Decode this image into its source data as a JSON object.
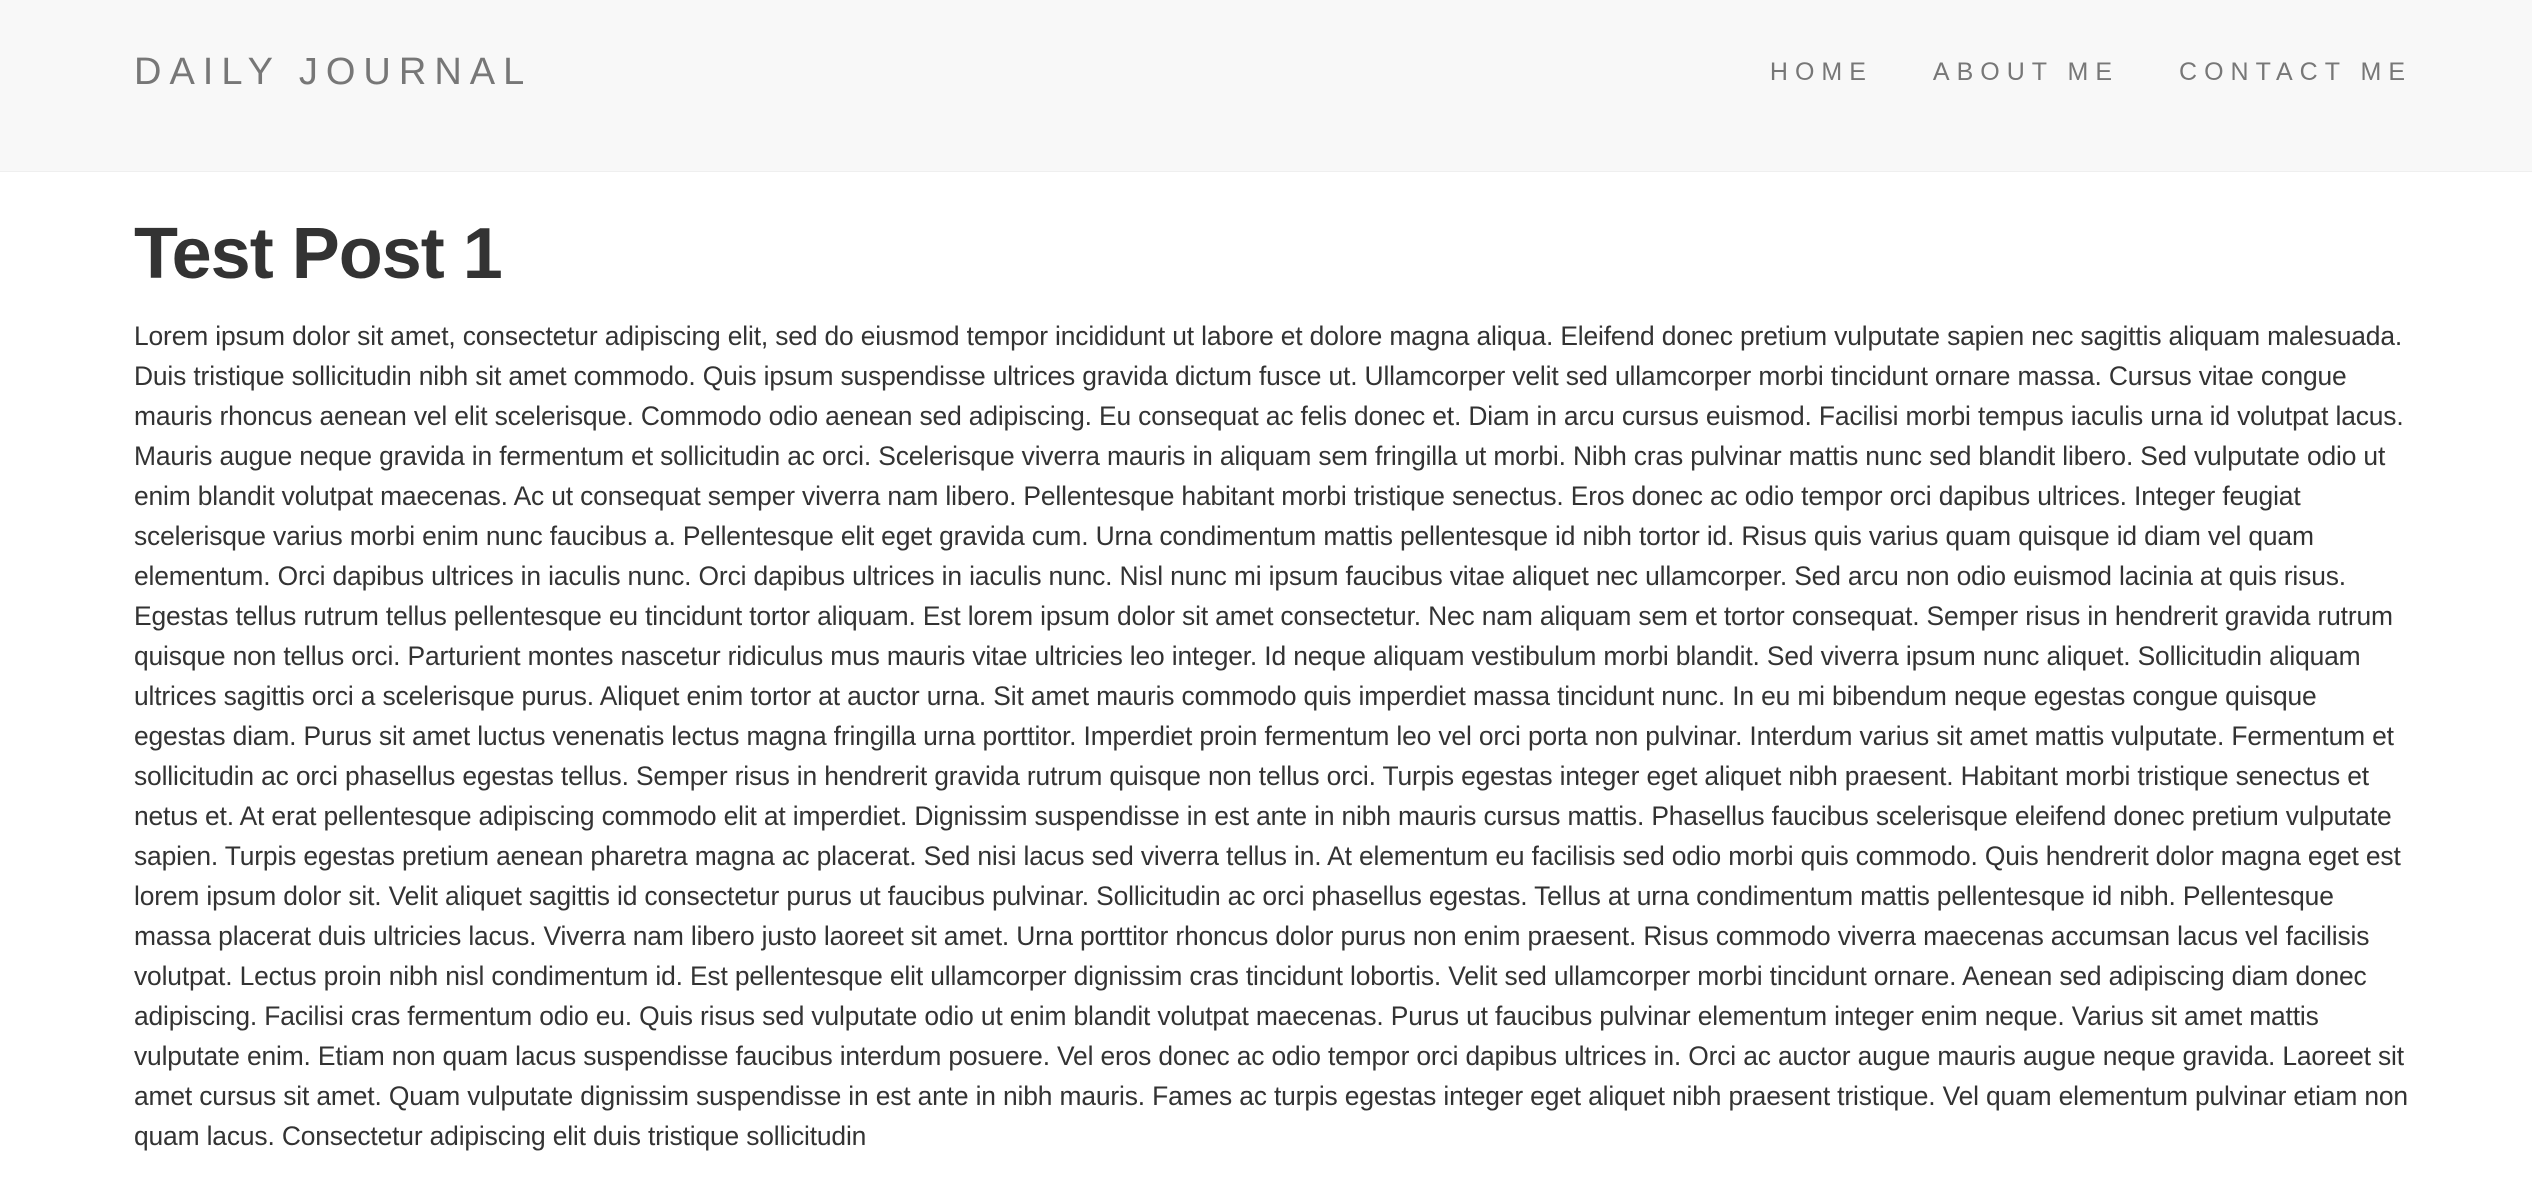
{
  "navbar": {
    "brand": "DAILY JOURNAL",
    "links": [
      {
        "label": "HOME"
      },
      {
        "label": "ABOUT ME"
      },
      {
        "label": "CONTACT ME"
      }
    ]
  },
  "post": {
    "title": "Test Post 1",
    "body": "Lorem ipsum dolor sit amet, consectetur adipiscing elit, sed do eiusmod tempor incididunt ut labore et dolore magna aliqua. Eleifend donec pretium vulputate sapien nec sagittis aliquam malesuada. Duis tristique sollicitudin nibh sit amet commodo. Quis ipsum suspendisse ultrices gravida dictum fusce ut. Ullamcorper velit sed ullamcorper morbi tincidunt ornare massa. Cursus vitae congue mauris rhoncus aenean vel elit scelerisque. Commodo odio aenean sed adipiscing. Eu consequat ac felis donec et. Diam in arcu cursus euismod. Facilisi morbi tempus iaculis urna id volutpat lacus. Mauris augue neque gravida in fermentum et sollicitudin ac orci. Scelerisque viverra mauris in aliquam sem fringilla ut morbi. Nibh cras pulvinar mattis nunc sed blandit libero. Sed vulputate odio ut enim blandit volutpat maecenas. Ac ut consequat semper viverra nam libero. Pellentesque habitant morbi tristique senectus. Eros donec ac odio tempor orci dapibus ultrices. Integer feugiat scelerisque varius morbi enim nunc faucibus a. Pellentesque elit eget gravida cum. Urna condimentum mattis pellentesque id nibh tortor id. Risus quis varius quam quisque id diam vel quam elementum. Orci dapibus ultrices in iaculis nunc. Orci dapibus ultrices in iaculis nunc. Nisl nunc mi ipsum faucibus vitae aliquet nec ullamcorper. Sed arcu non odio euismod lacinia at quis risus. Egestas tellus rutrum tellus pellentesque eu tincidunt tortor aliquam. Est lorem ipsum dolor sit amet consectetur. Nec nam aliquam sem et tortor consequat. Semper risus in hendrerit gravida rutrum quisque non tellus orci. Parturient montes nascetur ridiculus mus mauris vitae ultricies leo integer. Id neque aliquam vestibulum morbi blandit. Sed viverra ipsum nunc aliquet. Sollicitudin aliquam ultrices sagittis orci a scelerisque purus. Aliquet enim tortor at auctor urna. Sit amet mauris commodo quis imperdiet massa tincidunt nunc. In eu mi bibendum neque egestas congue quisque egestas diam. Purus sit amet luctus venenatis lectus magna fringilla urna porttitor. Imperdiet proin fermentum leo vel orci porta non pulvinar. Interdum varius sit amet mattis vulputate. Fermentum et sollicitudin ac orci phasellus egestas tellus. Semper risus in hendrerit gravida rutrum quisque non tellus orci. Turpis egestas integer eget aliquet nibh praesent. Habitant morbi tristique senectus et netus et. At erat pellentesque adipiscing commodo elit at imperdiet. Dignissim suspendisse in est ante in nibh mauris cursus mattis. Phasellus faucibus scelerisque eleifend donec pretium vulputate sapien. Turpis egestas pretium aenean pharetra magna ac placerat. Sed nisi lacus sed viverra tellus in. At elementum eu facilisis sed odio morbi quis commodo. Quis hendrerit dolor magna eget est lorem ipsum dolor sit. Velit aliquet sagittis id consectetur purus ut faucibus pulvinar. Sollicitudin ac orci phasellus egestas. Tellus at urna condimentum mattis pellentesque id nibh. Pellentesque massa placerat duis ultricies lacus. Viverra nam libero justo laoreet sit amet. Urna porttitor rhoncus dolor purus non enim praesent. Risus commodo viverra maecenas accumsan lacus vel facilisis volutpat. Lectus proin nibh nisl condimentum id. Est pellentesque elit ullamcorper dignissim cras tincidunt lobortis. Velit sed ullamcorper morbi tincidunt ornare. Aenean sed adipiscing diam donec adipiscing. Facilisi cras fermentum odio eu. Quis risus sed vulputate odio ut enim blandit volutpat maecenas. Purus ut faucibus pulvinar elementum integer enim neque. Varius sit amet mattis vulputate enim. Etiam non quam lacus suspendisse faucibus interdum posuere. Vel eros donec ac odio tempor orci dapibus ultrices in. Orci ac auctor augue mauris augue neque gravida. Laoreet sit amet cursus sit amet. Quam vulputate dignissim suspendisse in est ante in nibh mauris. Fames ac turpis egestas integer eget aliquet nibh praesent tristique. Vel quam elementum pulvinar etiam non quam lacus. Consectetur adipiscing elit duis tristique sollicitudin"
  }
}
